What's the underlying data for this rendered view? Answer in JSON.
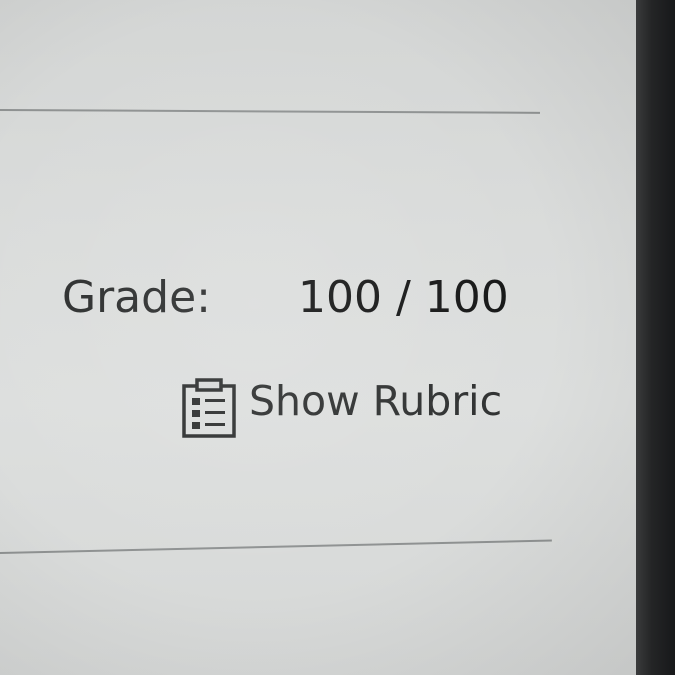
{
  "grade": {
    "label": "Grade:",
    "value": "100 / 100"
  },
  "rubric": {
    "label": "Show Rubric",
    "icon": "clipboard-list-icon"
  },
  "colors": {
    "screen_background": "#dadcdb",
    "text_primary": "#151616",
    "text_secondary": "#2b2d2d",
    "divider": "#8f9292",
    "bezel": "#242526"
  }
}
